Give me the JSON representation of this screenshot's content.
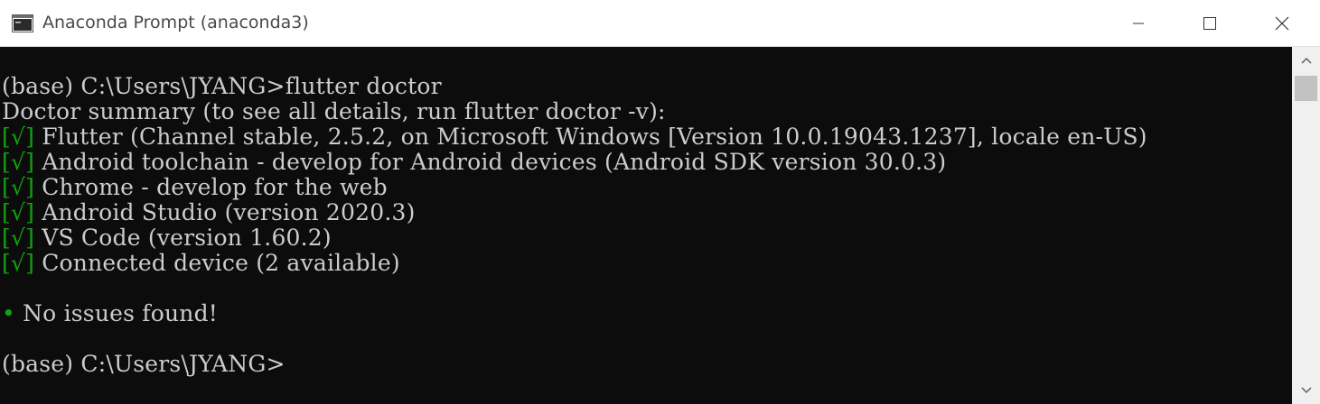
{
  "window": {
    "title": "Anaconda Prompt (anaconda3)",
    "icon": "console-icon"
  },
  "controls": {
    "minimize": "minimize-icon",
    "maximize": "maximize-icon",
    "close": "close-icon"
  },
  "console": {
    "lines": [
      {
        "check": "",
        "text": ""
      },
      {
        "check": "",
        "text": "(base) C:\\Users\\JYANG>flutter doctor"
      },
      {
        "check": "",
        "text": "Doctor summary (to see all details, run flutter doctor -v):"
      },
      {
        "check": "[√]",
        "text": " Flutter (Channel stable, 2.5.2, on Microsoft Windows [Version 10.0.19043.1237], locale en-US)"
      },
      {
        "check": "[√]",
        "text": " Android toolchain - develop for Android devices (Android SDK version 30.0.3)"
      },
      {
        "check": "[√]",
        "text": " Chrome - develop for the web"
      },
      {
        "check": "[√]",
        "text": " Android Studio (version 2020.3)"
      },
      {
        "check": "[√]",
        "text": " VS Code (version 1.60.2)"
      },
      {
        "check": "[√]",
        "text": " Connected device (2 available)"
      },
      {
        "check": "",
        "text": ""
      },
      {
        "check": "•",
        "text": " No issues found!"
      },
      {
        "check": "",
        "text": ""
      },
      {
        "check": "",
        "text": "(base) C:\\Users\\JYANG>"
      }
    ]
  },
  "colors": {
    "background": "#0c0c0c",
    "foreground": "#cccccc",
    "success": "#13a10e"
  }
}
